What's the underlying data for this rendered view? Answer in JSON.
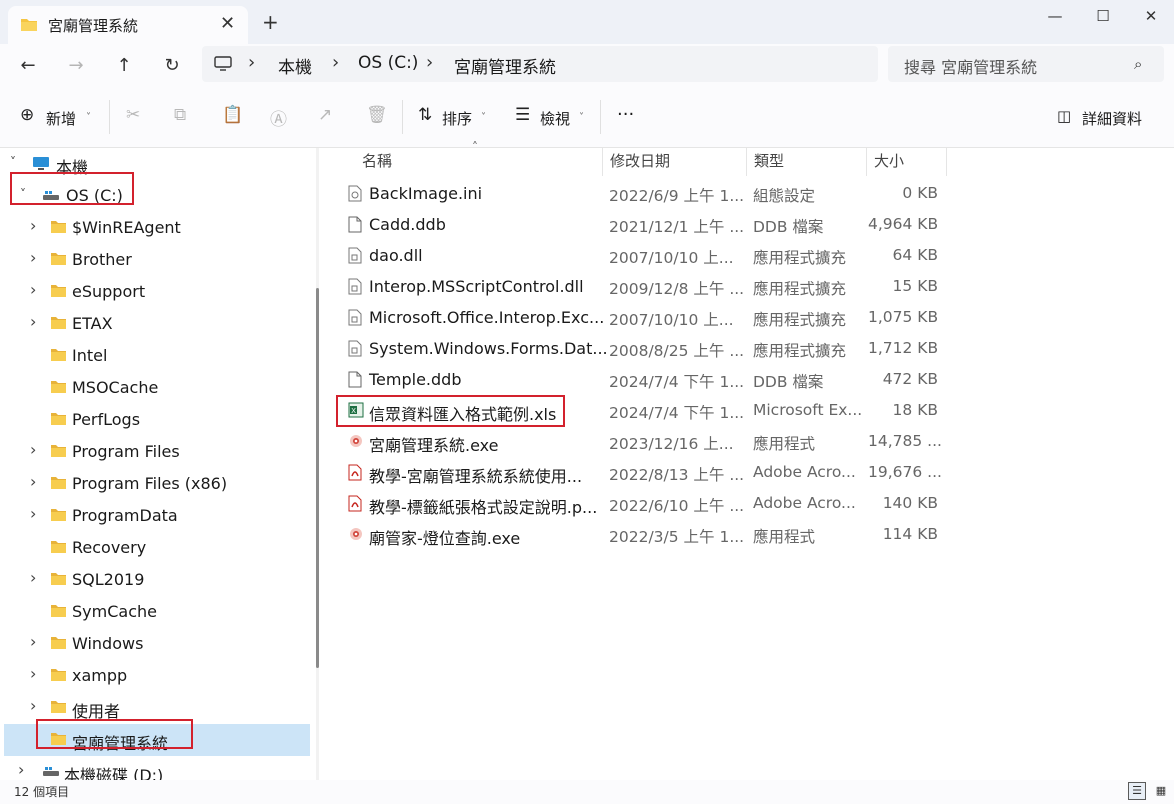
{
  "window": {
    "tab_title": "宮廟管理系統",
    "tab_close": "✕",
    "new_tab": "+",
    "minimize": "—",
    "maximize": "☐",
    "close": "✕"
  },
  "address": {
    "crumbs": [
      "本機",
      "OS (C:)",
      "宮廟管理系統"
    ],
    "separator": "›",
    "search_placeholder": "搜尋 宮廟管理系統"
  },
  "toolbar": {
    "new_label": "新增",
    "sort_label": "排序",
    "view_label": "檢視",
    "more_label": "···",
    "details_label": "詳細資料"
  },
  "nav": {
    "items": [
      {
        "label": "本機",
        "icon": "pc-icon",
        "level": 0,
        "expanded": true
      },
      {
        "label": "OS (C:)",
        "icon": "drive-icon",
        "level": 1,
        "expanded": true
      },
      {
        "label": "$WinREAgent",
        "icon": "folder-icon",
        "level": 2,
        "expandable": true
      },
      {
        "label": "Brother",
        "icon": "folder-icon",
        "level": 2,
        "expandable": true
      },
      {
        "label": "eSupport",
        "icon": "folder-icon",
        "level": 2,
        "expandable": true
      },
      {
        "label": "ETAX",
        "icon": "folder-icon",
        "level": 2,
        "expandable": true
      },
      {
        "label": "Intel",
        "icon": "folder-icon",
        "level": 2,
        "expandable": false
      },
      {
        "label": "MSOCache",
        "icon": "folder-icon",
        "level": 2,
        "expandable": false
      },
      {
        "label": "PerfLogs",
        "icon": "folder-icon",
        "level": 2,
        "expandable": false
      },
      {
        "label": "Program Files",
        "icon": "folder-icon",
        "level": 2,
        "expandable": true
      },
      {
        "label": "Program Files (x86)",
        "icon": "folder-icon",
        "level": 2,
        "expandable": true
      },
      {
        "label": "ProgramData",
        "icon": "folder-icon",
        "level": 2,
        "expandable": true
      },
      {
        "label": "Recovery",
        "icon": "folder-icon",
        "level": 2,
        "expandable": false
      },
      {
        "label": "SQL2019",
        "icon": "folder-icon",
        "level": 2,
        "expandable": true
      },
      {
        "label": "SymCache",
        "icon": "folder-icon",
        "level": 2,
        "expandable": false
      },
      {
        "label": "Windows",
        "icon": "folder-icon",
        "level": 2,
        "expandable": true
      },
      {
        "label": "xampp",
        "icon": "folder-icon",
        "level": 2,
        "expandable": true
      },
      {
        "label": "使用者",
        "icon": "folder-icon",
        "level": 2,
        "expandable": true
      },
      {
        "label": "宮廟管理系統",
        "icon": "folder-icon",
        "level": 2,
        "expandable": false,
        "selected": true
      },
      {
        "label": "本機磁碟 (D:)",
        "icon": "drive-icon",
        "level": 1,
        "expandable": true
      }
    ]
  },
  "columns": {
    "name": "名稱",
    "date": "修改日期",
    "type": "類型",
    "size": "大小",
    "sort_arrow": "˄"
  },
  "files": [
    {
      "name": "BackImage.ini",
      "date": "2022/6/9 上午 1...",
      "type": "組態設定",
      "size": "0 KB",
      "icon": "ini-file-icon"
    },
    {
      "name": "Cadd.ddb",
      "date": "2021/12/1 上午 ...",
      "type": "DDB 檔案",
      "size": "4,964 KB",
      "icon": "file-icon"
    },
    {
      "name": "dao.dll",
      "date": "2007/10/10 上...",
      "type": "應用程式擴充",
      "size": "64 KB",
      "icon": "dll-file-icon"
    },
    {
      "name": "Interop.MSScriptControl.dll",
      "date": "2009/12/8 上午 ...",
      "type": "應用程式擴充",
      "size": "15 KB",
      "icon": "dll-file-icon"
    },
    {
      "name": "Microsoft.Office.Interop.Exc...",
      "date": "2007/10/10 上...",
      "type": "應用程式擴充",
      "size": "1,075 KB",
      "icon": "dll-file-icon"
    },
    {
      "name": "System.Windows.Forms.Dat...",
      "date": "2008/8/25 上午 ...",
      "type": "應用程式擴充",
      "size": "1,712 KB",
      "icon": "dll-file-icon"
    },
    {
      "name": "Temple.ddb",
      "date": "2024/7/4 下午 1...",
      "type": "DDB 檔案",
      "size": "472 KB",
      "icon": "file-icon"
    },
    {
      "name": "信眾資料匯入格式範例.xls",
      "date": "2024/7/4 下午 1...",
      "type": "Microsoft Ex...",
      "size": "18 KB",
      "icon": "excel-file-icon"
    },
    {
      "name": "宮廟管理系統.exe",
      "date": "2023/12/16 上...",
      "type": "應用程式",
      "size": "14,785 ...",
      "icon": "exe-icon"
    },
    {
      "name": "教學-宮廟管理系統系統使用...",
      "date": "2022/8/13 上午 ...",
      "type": "Adobe Acro...",
      "size": "19,676 ...",
      "icon": "pdf-file-icon"
    },
    {
      "name": "教學-標籤紙張格式設定說明.p...",
      "date": "2022/6/10 上午 ...",
      "type": "Adobe Acro...",
      "size": "140 KB",
      "icon": "pdf-file-icon"
    },
    {
      "name": "廟管家-燈位查詢.exe",
      "date": "2022/3/5 上午 1...",
      "type": "應用程式",
      "size": "114 KB",
      "icon": "exe-icon"
    }
  ],
  "status": {
    "item_count": "12 個項目"
  },
  "colors": {
    "highlight": "#d3212d",
    "selection": "#cce4f7",
    "folder": "#f5c542"
  }
}
